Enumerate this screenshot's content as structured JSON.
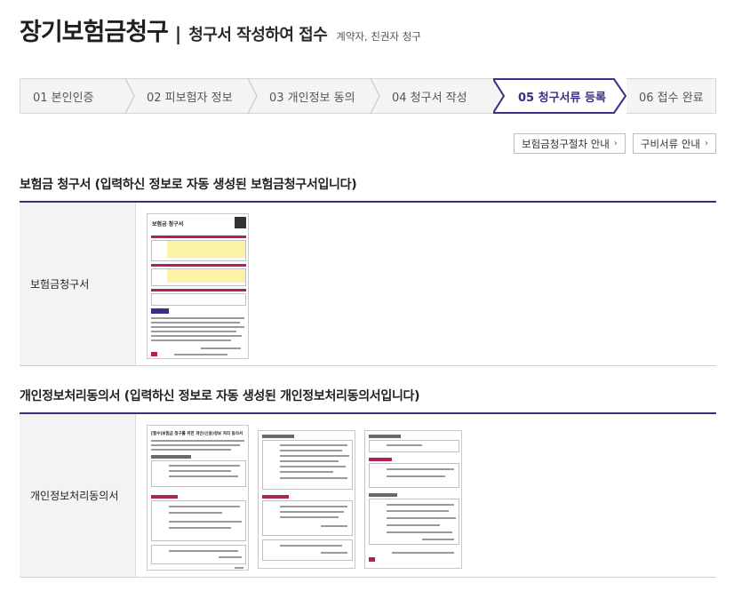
{
  "header": {
    "title": "장기보험금청구",
    "separator": "|",
    "subtitle": "청구서 작성하여 접수",
    "note": "계약자, 친권자 청구"
  },
  "steps": [
    {
      "label": "01  본인인증",
      "active": false
    },
    {
      "label": "02  피보험자 정보",
      "active": false
    },
    {
      "label": "03  개인정보 동의",
      "active": false
    },
    {
      "label": "04  청구서 작성",
      "active": false
    },
    {
      "label": "05  청구서류 등록",
      "active": true
    },
    {
      "label": "06  접수 완료",
      "active": false
    }
  ],
  "buttons": {
    "guide": "보험금청구절차 안내",
    "docs": "구비서류 안내",
    "chevron": "›"
  },
  "sections": {
    "claim": {
      "title": "보험금 청구서 (입력하신 정보로 자동 생성된 보험금청구서입니다)",
      "row_label": "보험금청구서",
      "thumb_title": "보험금 청구서"
    },
    "consent": {
      "title": "개인정보처리동의서 (입력하신 정보로 자동 생성된 개인정보처리동의서입니다)",
      "row_label": "개인정보처리동의서",
      "thumb_title": "[필수]보험금 청구를 위한 개인(신용)정보 처리 동의서"
    }
  },
  "colors": {
    "accent": "#3e2c86",
    "rule": "#3d2e7c",
    "doc_red": "#b0205a"
  }
}
